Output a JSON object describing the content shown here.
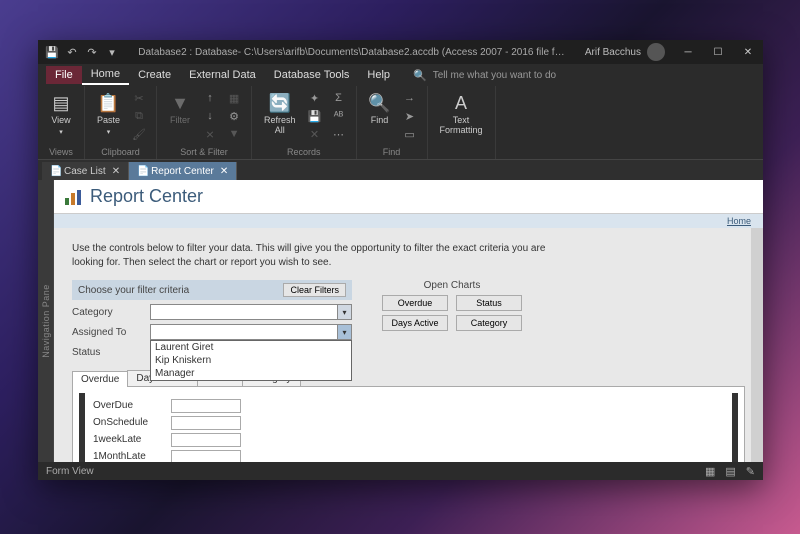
{
  "titlebar": {
    "title": "Database2 : Database- C:\\Users\\arifb\\Documents\\Database2.accdb (Access 2007 - 2016 file f…",
    "user": "Arif Bacchus"
  },
  "menu": {
    "file": "File",
    "items": [
      "Home",
      "Create",
      "External Data",
      "Database Tools",
      "Help"
    ],
    "tell_me": "Tell me what you want to do"
  },
  "ribbon": {
    "views": {
      "view": "View",
      "group": "Views"
    },
    "clipboard": {
      "paste": "Paste",
      "group": "Clipboard"
    },
    "sort_filter": {
      "filter": "Filter",
      "group": "Sort & Filter"
    },
    "records": {
      "refresh": "Refresh\nAll",
      "group": "Records"
    },
    "find": {
      "find": "Find",
      "group": "Find"
    },
    "text": {
      "text_fmt": "Text\nFormatting",
      "group": ""
    }
  },
  "tabs": {
    "case_list": "Case List",
    "report_center": "Report Center"
  },
  "nav_pane": "Navigation Pane",
  "form": {
    "title": "Report Center",
    "home_link": "Home",
    "intro": "Use the controls below to filter your data. This will give you the opportunity to filter the exact criteria you are looking for. Then select the chart or report you wish to see.",
    "criteria_header": "Choose your filter criteria",
    "clear_filters": "Clear Filters",
    "labels": {
      "category": "Category",
      "assigned_to": "Assigned To",
      "status": "Status"
    },
    "assigned_options": [
      "Laurent Giret",
      "Kip Kniskern",
      "Manager"
    ],
    "open_charts": "Open Charts",
    "chart_buttons": {
      "overdue": "Overdue",
      "status": "Status",
      "days_active": "Days Active",
      "category": "Category"
    },
    "subtabs": [
      "Overdue",
      "Days Active",
      "Status",
      "Category"
    ],
    "data_rows": [
      "OverDue",
      "OnSchedule",
      "1weekLate",
      "1MonthLate"
    ]
  },
  "statusbar": {
    "view": "Form View"
  }
}
